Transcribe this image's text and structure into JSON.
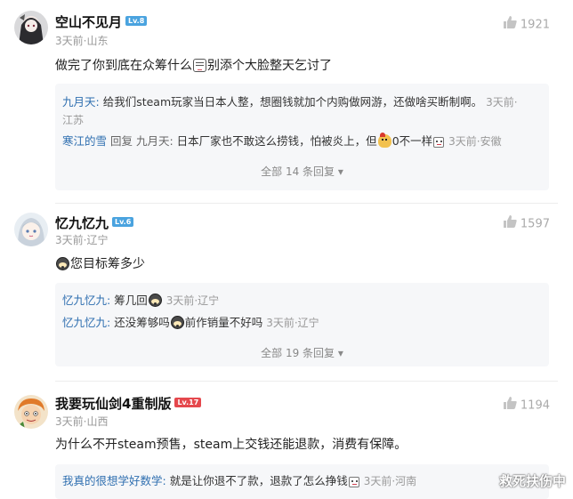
{
  "comments": [
    {
      "username": "空山不见月",
      "level": "Lv.8",
      "meta": "3天前·山东",
      "likes": "1921",
      "content": "做完了你到底在众筹什么",
      "content_tail": "别添个大脸整天乞讨了",
      "replies": [
        {
          "name": "九月天",
          "colon": ":",
          "text_line1": " 给我们steam玩家当日本人整，想圈钱就加个内购做网游，还做啥买断制啊。",
          "time": "3天前·",
          "line2": "江苏"
        },
        {
          "name": "寒江的雪",
          "reply_word": " 回复 ",
          "reply_to": "九月天",
          "colon": ":",
          "text": " 日本厂家也不敢这么捞钱，怕被炎上，但",
          "text2": "0不一样",
          "time": "3天前·安徽"
        }
      ],
      "more": "全部 14 条回复 ▾"
    },
    {
      "username": "忆九忆九",
      "level": "Lv.6",
      "meta": "3天前·辽宁",
      "likes": "1597",
      "content": "您目标筹多少",
      "replies": [
        {
          "name": "忆九忆九",
          "colon": ":",
          "text": " 筹几回",
          "time": "3天前·辽宁"
        },
        {
          "name": "忆九忆九",
          "colon": ":",
          "text": " 还没筹够吗",
          "text2": "前作销量不好吗",
          "time": "3天前·辽宁"
        }
      ],
      "more": "全部 19 条回复 ▾"
    },
    {
      "username": "我要玩仙剑4重制版",
      "level": "Lv.17",
      "meta": "3天前·山西",
      "likes": "1194",
      "content": "为什么不开steam预售，steam上交钱还能退款，消费有保障。",
      "replies": [
        {
          "name": "我真的很想学好数学",
          "colon": ":",
          "text": " 就是让你退不了款，退款了怎么挣钱",
          "time": "3天前·河南"
        }
      ]
    }
  ],
  "watermark": "救死扶伤中",
  "colors": {
    "accent_blue": "#2f6fb0",
    "level_badge": "#4aa3df",
    "level_badge_high": "#e5484d"
  }
}
